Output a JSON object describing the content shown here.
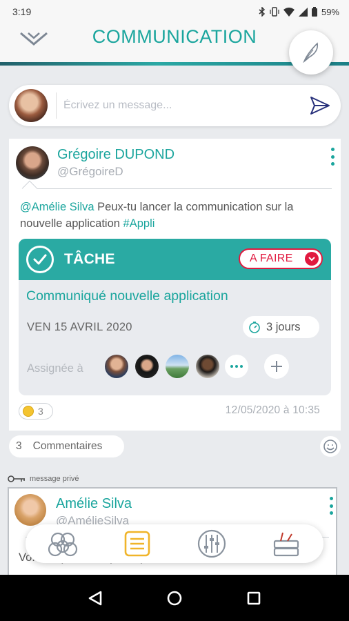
{
  "status_bar": {
    "time": "3:19",
    "battery": "59%"
  },
  "header": {
    "title": "COMMUNICATION"
  },
  "composer": {
    "placeholder": "Écrivez un message..."
  },
  "post": {
    "author_name": "Grégoire DUPOND",
    "author_handle": "@GrégoireD",
    "text_mention": "@Amélie Silva",
    "text_body": " Peux-tu lancer la communication sur la nouvelle application ",
    "text_hashtag": "#Appli",
    "task": {
      "label": "TÂCHE",
      "status": "A FAIRE",
      "title": "Communiqué nouvelle application",
      "date": "VEN 15 AVRIL 2020",
      "duration": "3 jours",
      "assigned_label": "Assignée à",
      "assignees": [
        "avatar-1",
        "avatar-2",
        "avatar-3",
        "avatar-4"
      ]
    },
    "reaction_count": "3",
    "timestamp": "12/05/2020 à 10:35"
  },
  "comments": {
    "count": "3",
    "label": "Commentaires"
  },
  "private_label": "message privé",
  "post2": {
    "author_name": "Amélie Silva",
    "author_handle": "@AmélieSilva",
    "text": "Vo... auquel nous participons"
  },
  "bottom_nav": {
    "items": [
      {
        "icon": "community-icon"
      },
      {
        "icon": "feed-icon",
        "active": true
      },
      {
        "icon": "settings-sliders-icon"
      },
      {
        "icon": "tools-icon"
      }
    ]
  },
  "colors": {
    "accent": "#1aa59d",
    "task_header": "#2aaaa3",
    "status_red": "#e1193f",
    "active_nav": "#f0b429"
  }
}
